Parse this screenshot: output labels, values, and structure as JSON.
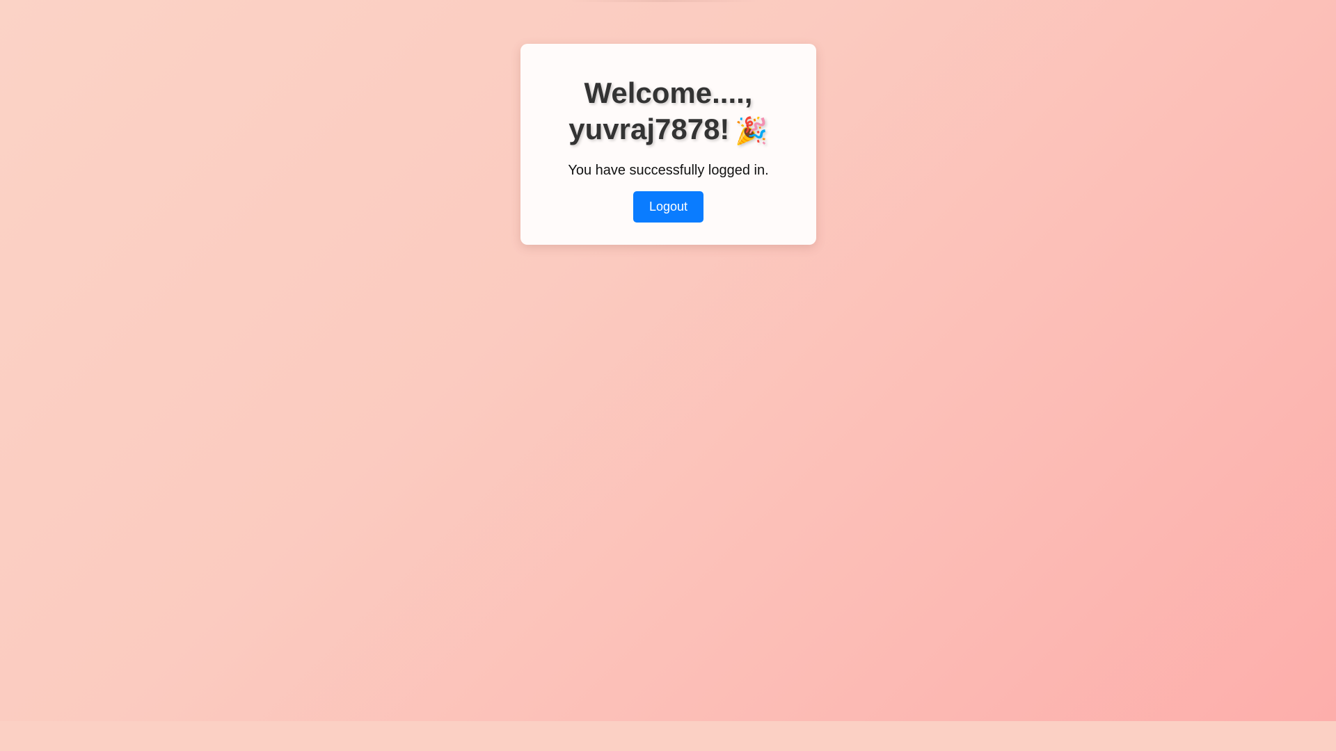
{
  "welcome": {
    "line1": "Welcome....,",
    "username": "yuvraj7878!",
    "icon": "party-popper-icon",
    "icon_glyph": "🎉"
  },
  "message": "You have successfully logged in.",
  "logout_label": "Logout",
  "colors": {
    "button": "#0a7cff",
    "heading": "#333333",
    "background_start": "#fbd3c6",
    "background_end": "#fdaeab"
  }
}
